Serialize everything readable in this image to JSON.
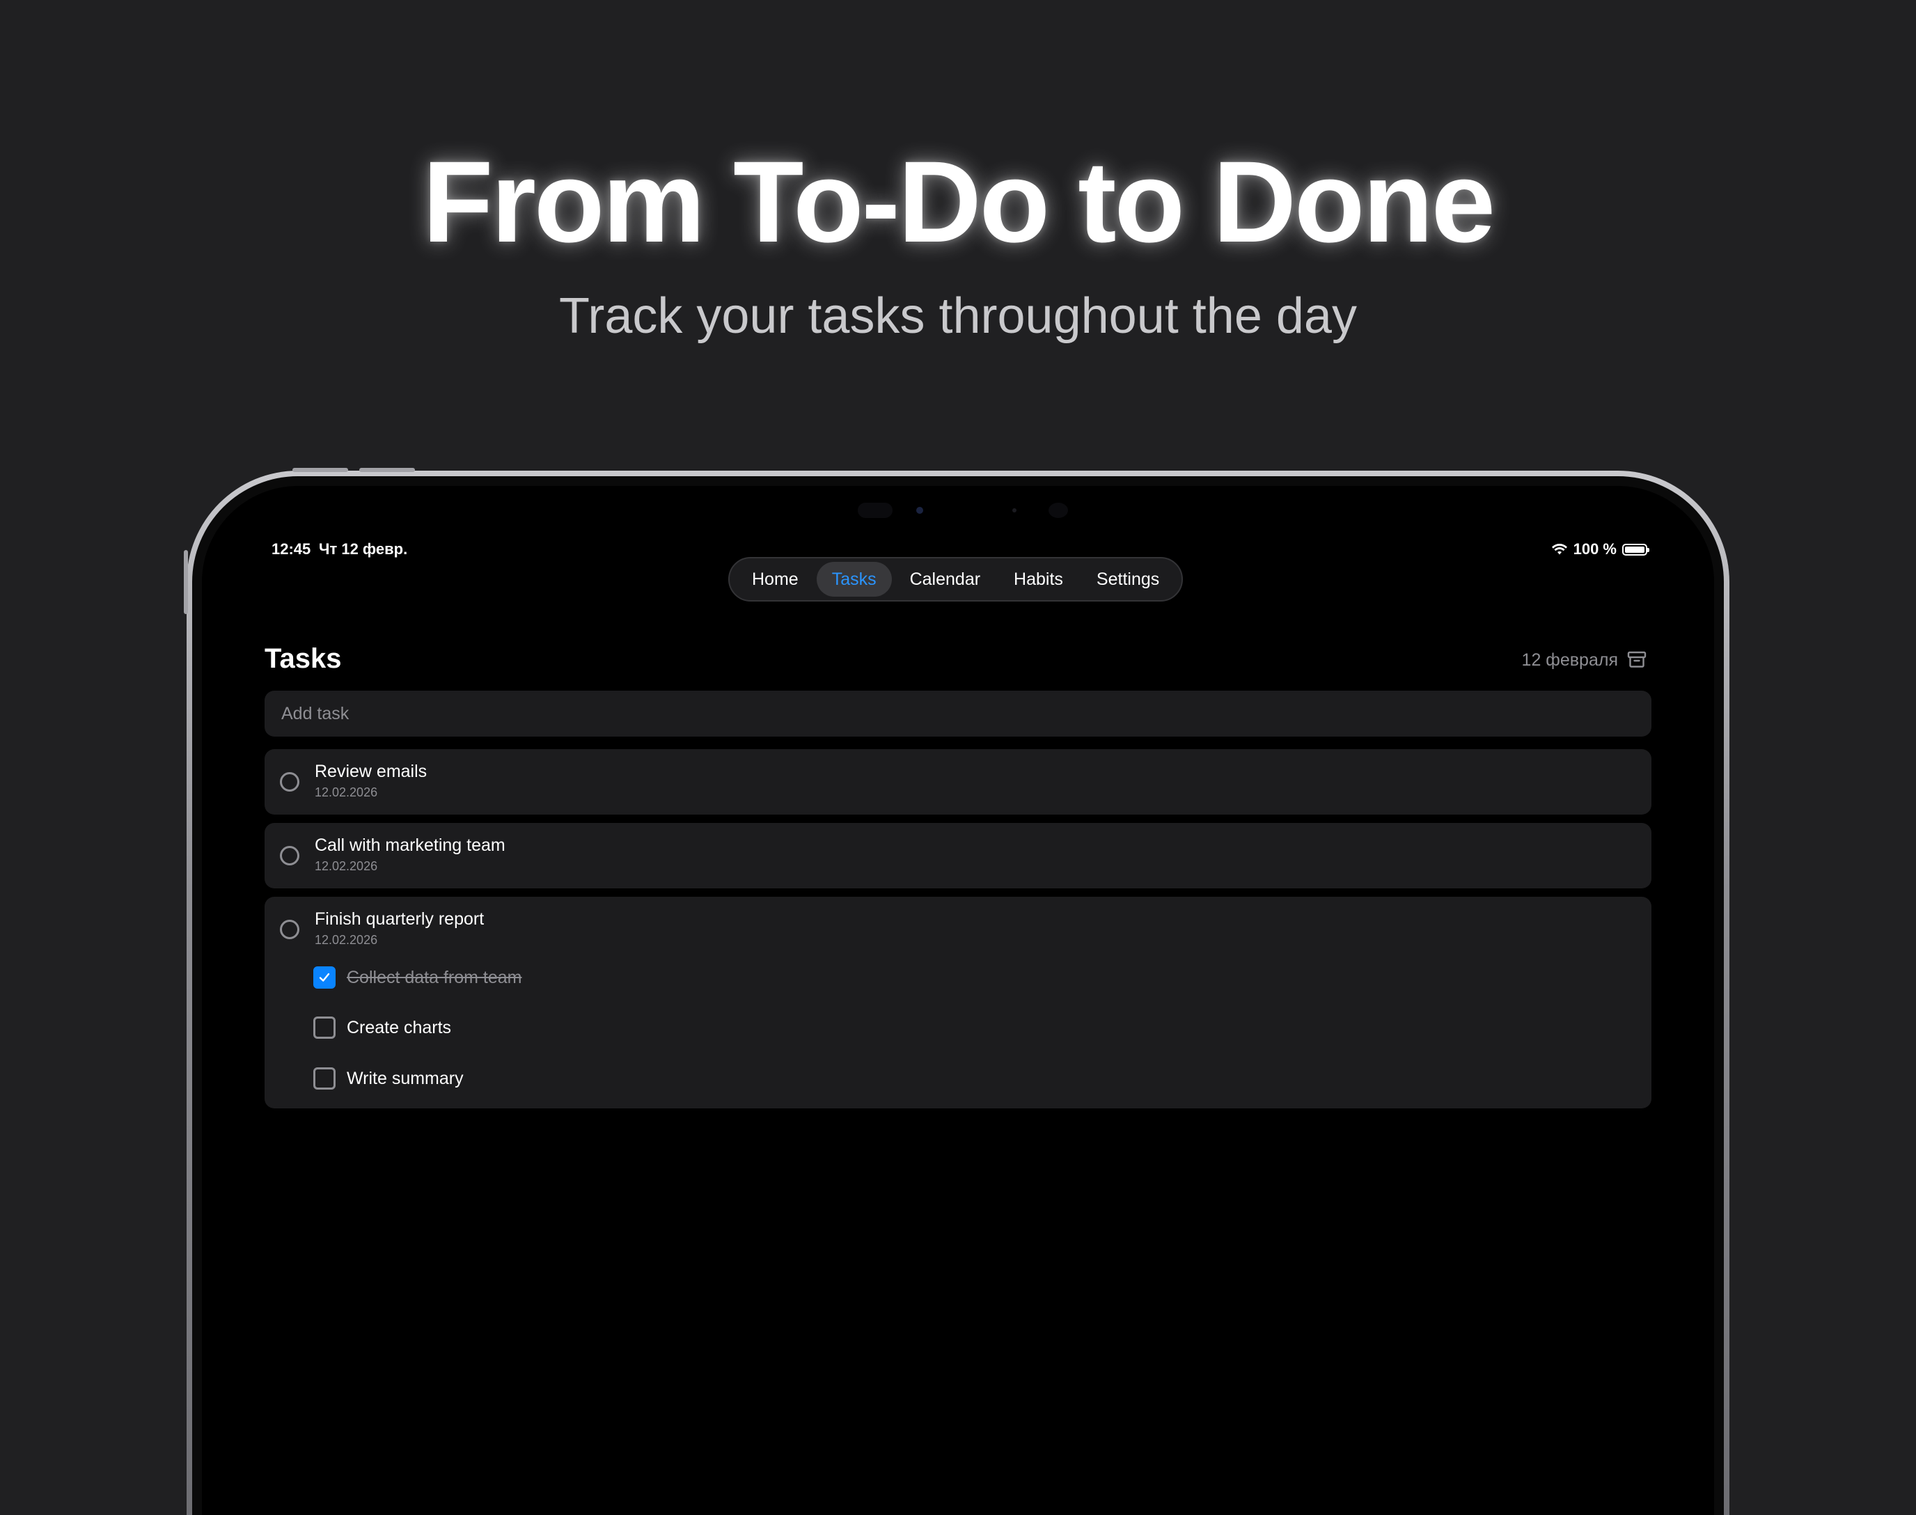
{
  "hero": {
    "title": "From To-Do to Done",
    "subtitle": "Track your tasks throughout the day"
  },
  "status_bar": {
    "time": "12:45",
    "date": "Чт 12 февр.",
    "battery": "100 %",
    "battery_level": 1.0
  },
  "tabs": [
    {
      "label": "Home",
      "active": false
    },
    {
      "label": "Tasks",
      "active": true
    },
    {
      "label": "Calendar",
      "active": false
    },
    {
      "label": "Habits",
      "active": false
    },
    {
      "label": "Settings",
      "active": false
    }
  ],
  "page": {
    "title": "Tasks",
    "date": "12 февраля",
    "add_task_placeholder": "Add task"
  },
  "tasks": [
    {
      "title": "Review emails",
      "date": "12.02.2026",
      "done": false
    },
    {
      "title": "Call with marketing team",
      "date": "12.02.2026",
      "done": false
    },
    {
      "title": "Finish quarterly report",
      "date": "12.02.2026",
      "done": false,
      "subtasks": [
        {
          "label": "Collect data from team",
          "done": true
        },
        {
          "label": "Create charts",
          "done": false
        },
        {
          "label": "Write summary",
          "done": false
        }
      ]
    }
  ],
  "colors": {
    "background": "#202022",
    "accent": "#0a84ff",
    "active_tab_text": "#2b95ff",
    "card": "#1c1c1e",
    "secondary_text": "#8e8e93"
  },
  "icons": {
    "wifi": "wifi-icon",
    "battery": "battery-icon",
    "archive": "archive-icon",
    "checkmark": "checkmark-icon"
  }
}
